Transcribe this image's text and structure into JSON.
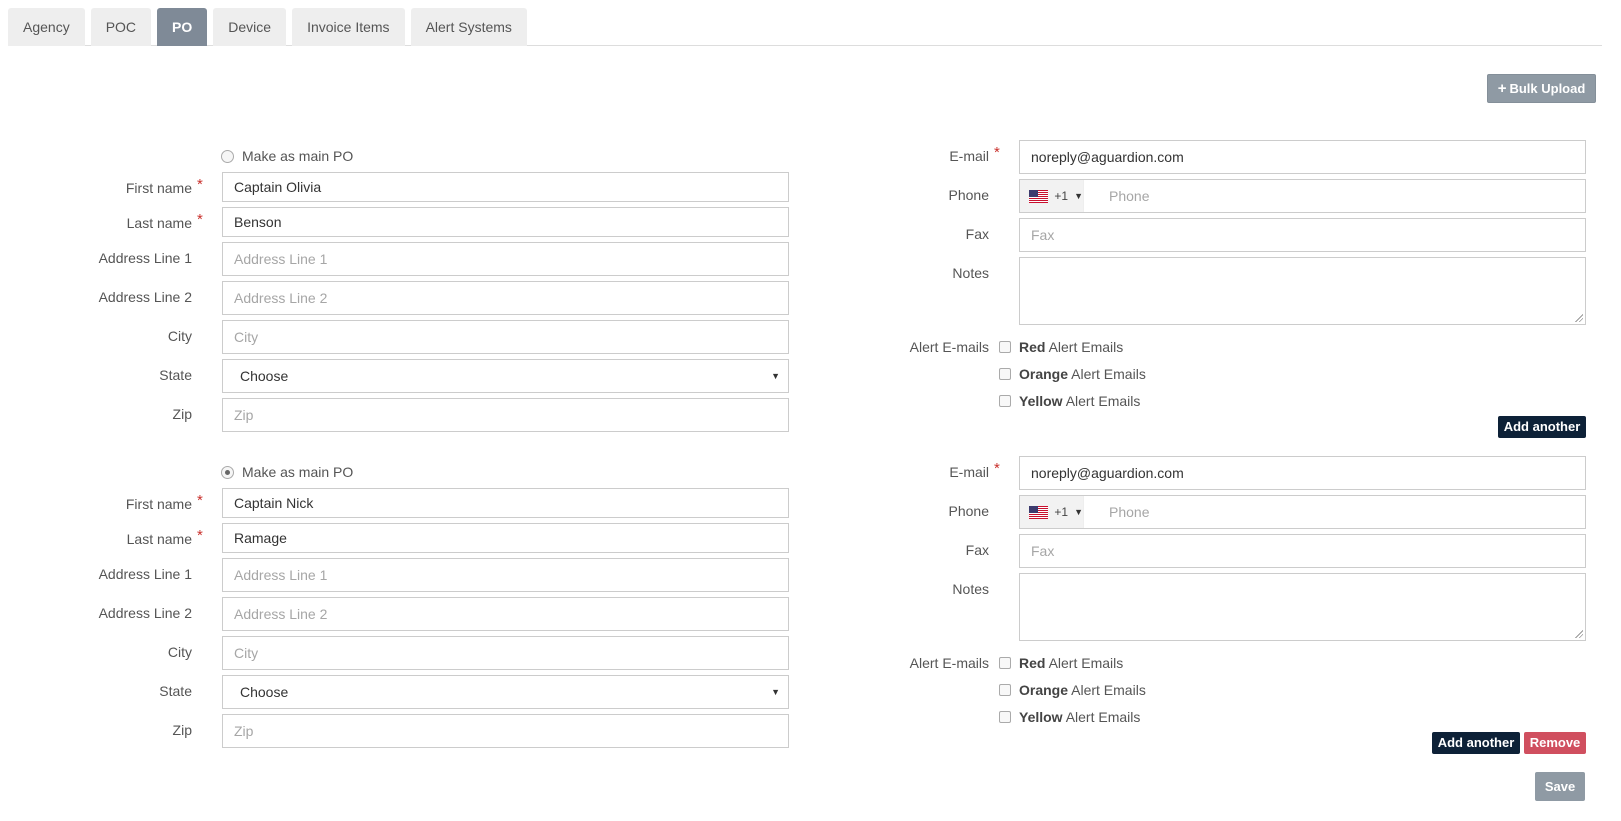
{
  "tabs": [
    {
      "label": "Agency"
    },
    {
      "label": "POC"
    },
    {
      "label": "PO",
      "active": true
    },
    {
      "label": "Device"
    },
    {
      "label": "Invoice Items"
    },
    {
      "label": "Alert Systems"
    }
  ],
  "bulk_upload_label": "Bulk Upload",
  "labels": {
    "make_main": "Make as main PO",
    "first_name": "First name",
    "last_name": "Last name",
    "address1": "Address Line 1",
    "address2": "Address Line 2",
    "city": "City",
    "state": "State",
    "zip": "Zip",
    "email": "E-mail",
    "phone": "Phone",
    "fax": "Fax",
    "notes": "Notes",
    "alert_emails": "Alert E-mails",
    "required": "*"
  },
  "placeholders": {
    "address1": "Address Line 1",
    "address2": "Address Line 2",
    "city": "City",
    "zip": "Zip",
    "phone": "Phone",
    "fax": "Fax"
  },
  "alert_options": [
    {
      "strong": "Red",
      "rest": " Alert Emails"
    },
    {
      "strong": "Orange",
      "rest": " Alert Emails"
    },
    {
      "strong": "Yellow",
      "rest": " Alert Emails"
    }
  ],
  "pos": [
    {
      "main": false,
      "first_name": "Captain Olivia",
      "last_name": "Benson",
      "state": "Choose",
      "email": "noreply@aguardion.com",
      "phone_code": "+1"
    },
    {
      "main": true,
      "first_name": "Captain Nick",
      "last_name": "Ramage",
      "state": "Choose",
      "email": "noreply@aguardion.com",
      "phone_code": "+1"
    }
  ],
  "buttons": {
    "add_another": "Add another",
    "remove": "Remove",
    "save": "Save"
  }
}
